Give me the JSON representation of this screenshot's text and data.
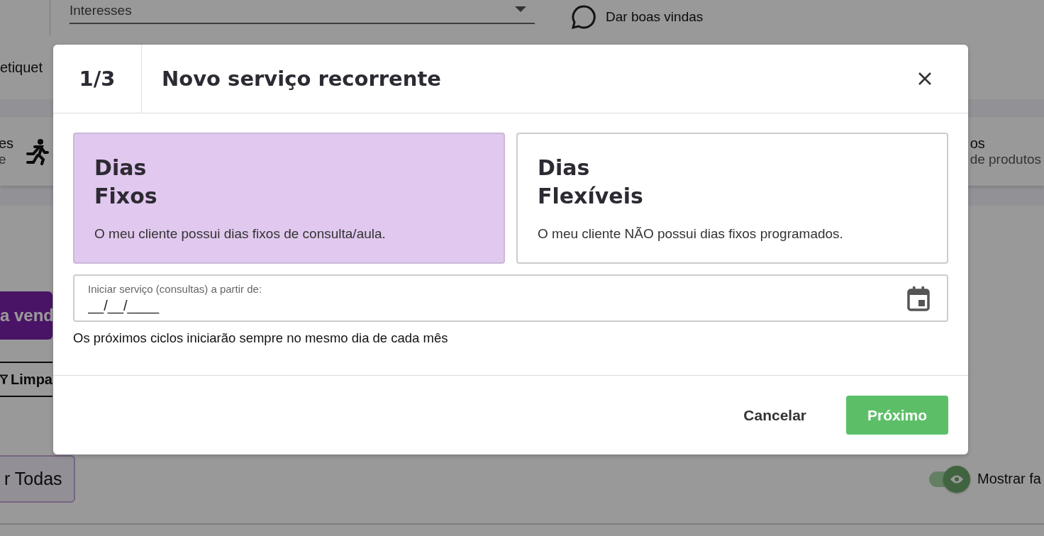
{
  "background": {
    "interests_field": {
      "placeholder": "Interesses"
    },
    "welcome_link": "Dar boas vindas",
    "tags_label": "etiquet",
    "strip": {
      "left_title": "es",
      "left_sub": "e",
      "right_title": "os",
      "right_sub": "de produtos"
    },
    "sale_button": "a vend",
    "clear_button": "Limpa",
    "all_button": "r Todas",
    "show_toggle": {
      "label": "Mostrar fa",
      "on": true
    }
  },
  "dialog": {
    "step": "1/3",
    "title": "Novo serviço recorrente",
    "options": [
      {
        "title": "Dias\nFixos",
        "description": "O meu cliente possui dias fixos de consulta/aula.",
        "selected": true
      },
      {
        "title": "Dias\nFlexíveis",
        "description": "O meu cliente NÃO possui dias fixos programados.",
        "selected": false
      }
    ],
    "start_field": {
      "label": "Iniciar serviço (consultas) a partir de:",
      "placeholder": "__/__/____"
    },
    "hint": "Os próximos ciclos iniciarão sempre no mesmo dia de cada mês",
    "buttons": [
      {
        "label": "Cancelar",
        "kind": "text"
      },
      {
        "label": "Próximo",
        "kind": "primary"
      }
    ]
  }
}
